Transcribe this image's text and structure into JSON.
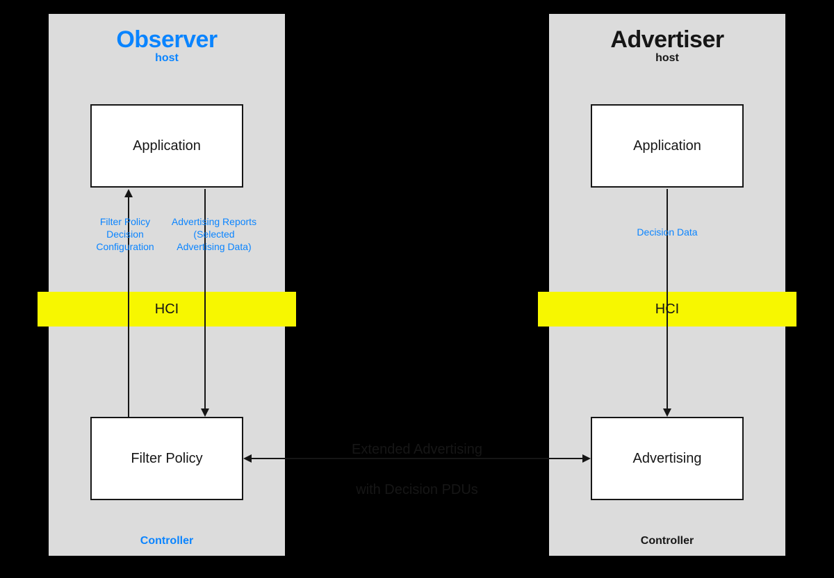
{
  "observer": {
    "title": "Observer",
    "subtitle": "host",
    "application_label": "Application",
    "filter_policy_label": "Filter Policy",
    "hci_label": "HCI",
    "controller_label": "Controller",
    "annotation_left": "Filter Policy\nDecision\nConfiguration",
    "annotation_right": "Advertising Reports\n(Selected\nAdvertising Data)"
  },
  "advertiser": {
    "title": "Advertiser",
    "subtitle": "host",
    "application_label": "Application",
    "advertising_label": "Advertising",
    "hci_label": "HCI",
    "controller_label": "Controller",
    "annotation": "Decision Data"
  },
  "center": {
    "label": "Extended Advertising\nwith Decision PDUs"
  }
}
